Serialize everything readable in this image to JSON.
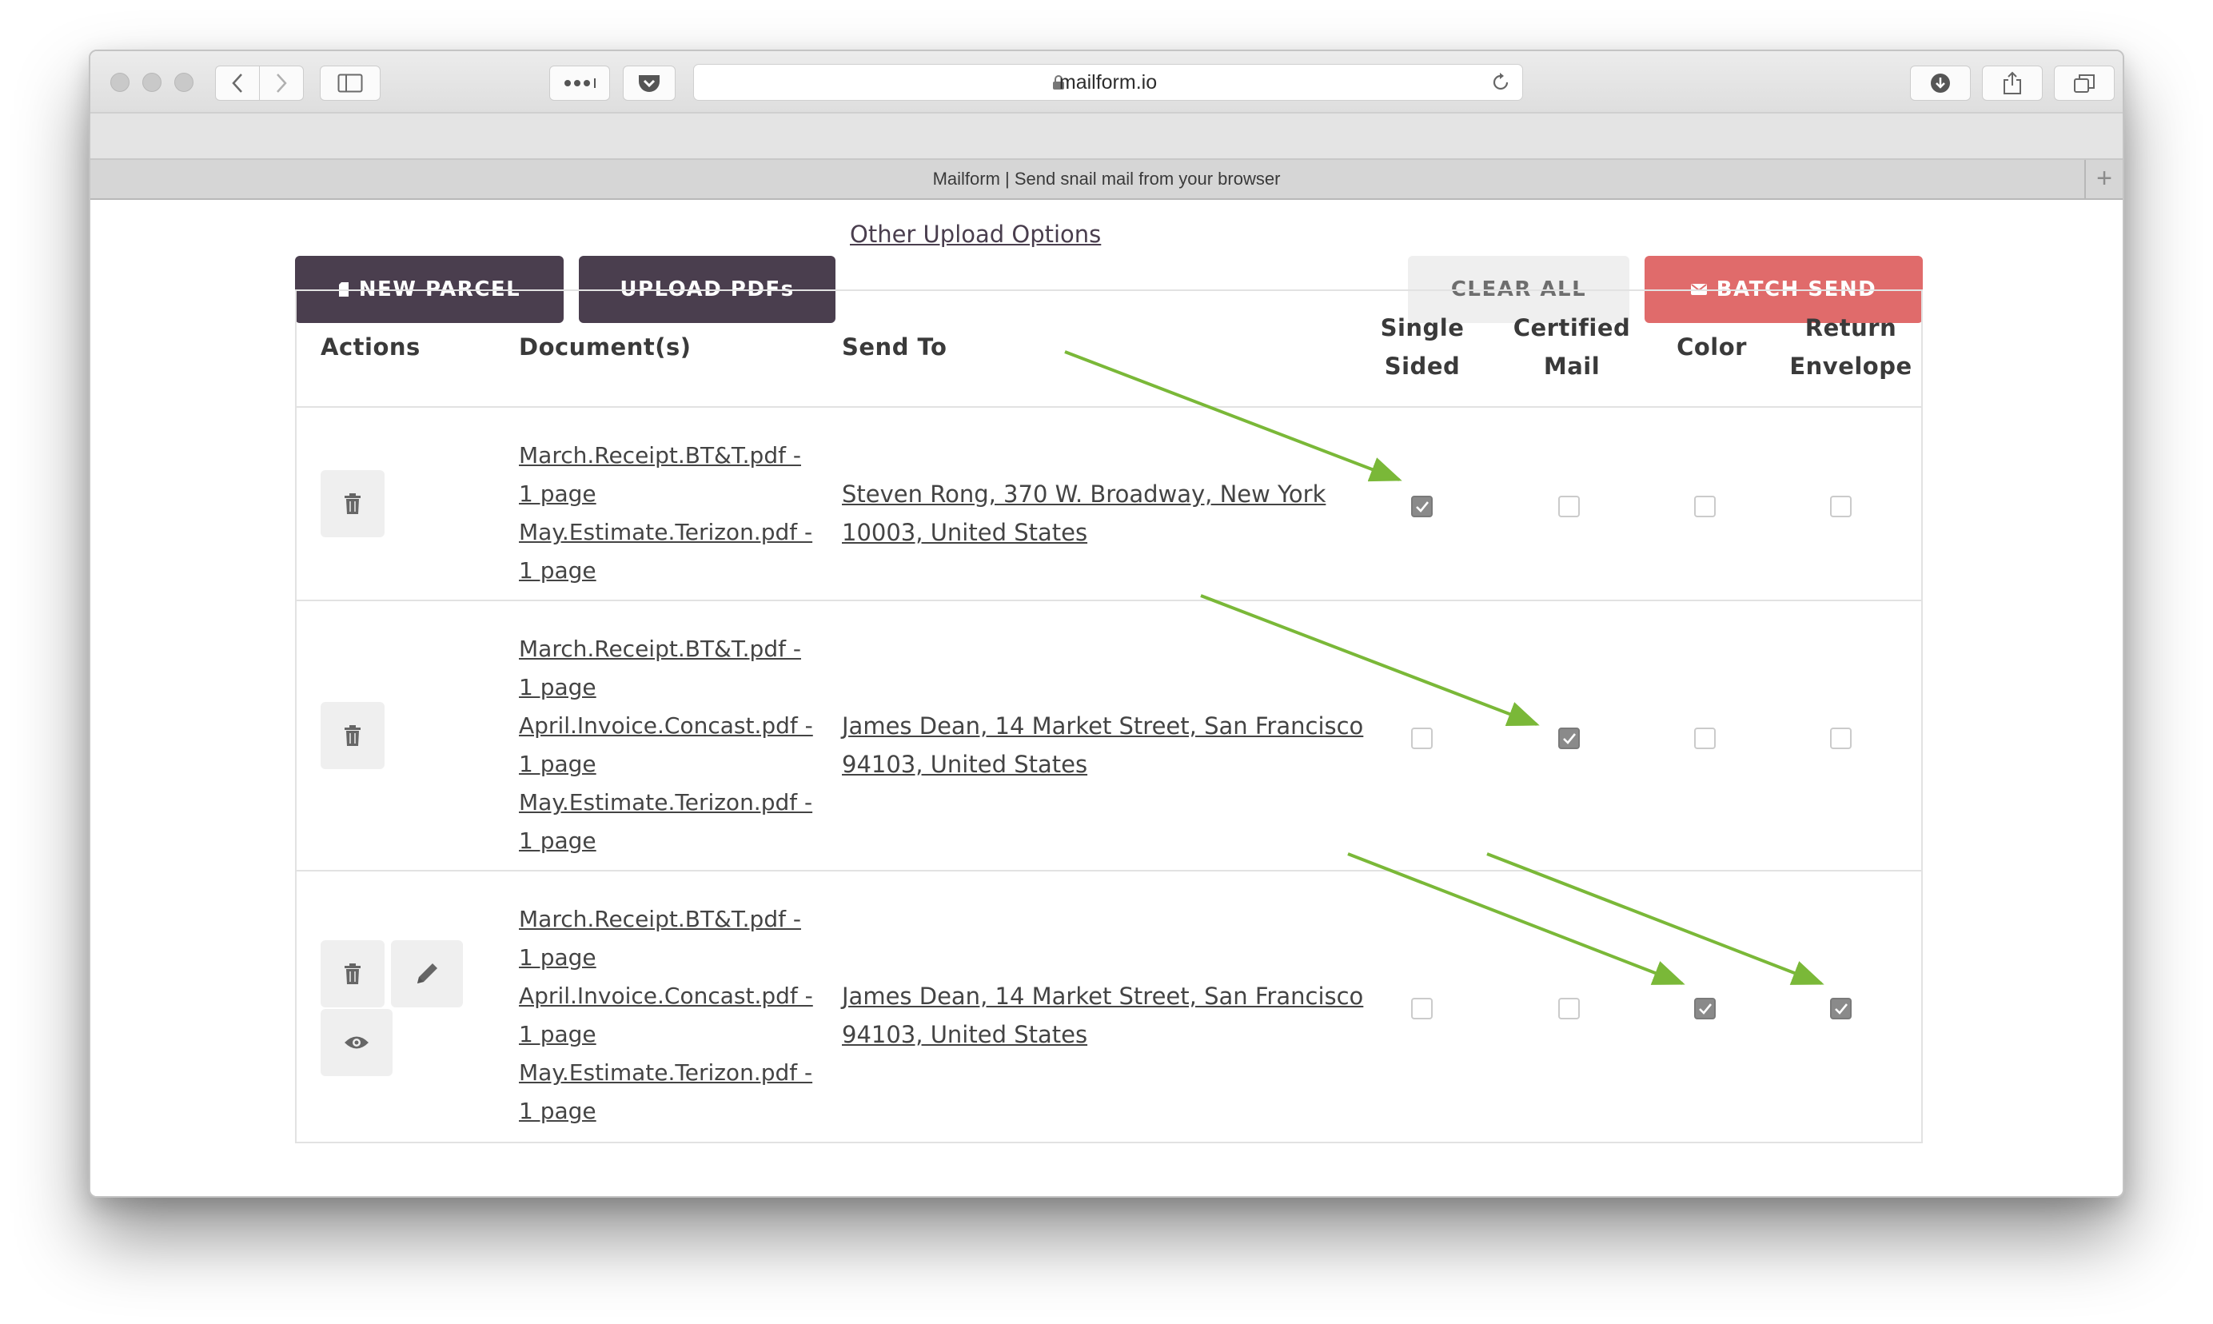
{
  "browser": {
    "url_host": "mailform.io",
    "tab_title": "Mailform | Send snail mail from your browser",
    "new_tab": "+"
  },
  "toolbar": {
    "new_parcel": "NEW PARCEL",
    "upload_pdfs": "UPLOAD PDFs",
    "other_upload": "Other Upload Options",
    "clear_all": "CLEAR ALL",
    "batch_send": "BATCH SEND"
  },
  "table": {
    "headers": {
      "actions": "Actions",
      "documents": "Document(s)",
      "send_to": "Send To",
      "single_1": "Single",
      "single_2": "Sided",
      "certified_1": "Certified",
      "certified_2": "Mail",
      "color": "Color",
      "return_1": "Return",
      "return_2": "Envelope"
    },
    "rows": [
      {
        "docs": [
          "March.Receipt.BT&T.pdf -",
          "1 page",
          "May.Estimate.Terizon.pdf -",
          "1 page"
        ],
        "address_1": "Steven Rong, 370 W. Broadway, New York",
        "address_2": "10003, United States",
        "single_sided": true,
        "certified": false,
        "color": false,
        "return_envelope": false
      },
      {
        "docs": [
          "March.Receipt.BT&T.pdf -",
          "1 page",
          "April.Invoice.Concast.pdf -",
          "1 page",
          "May.Estimate.Terizon.pdf -",
          "1 page"
        ],
        "address_1": "James Dean, 14 Market Street, San Francisco",
        "address_2": "94103, United States",
        "single_sided": false,
        "certified": true,
        "color": false,
        "return_envelope": false
      },
      {
        "docs": [
          "March.Receipt.BT&T.pdf -",
          "1 page",
          "April.Invoice.Concast.pdf -",
          "1 page",
          "May.Estimate.Terizon.pdf -",
          "1 page"
        ],
        "address_1": "James Dean, 14 Market Street, San Francisco",
        "address_2": "94103, United States",
        "single_sided": false,
        "certified": false,
        "color": true,
        "return_envelope": true
      }
    ]
  },
  "colors": {
    "dark_button": "#4a3e4e",
    "batch_send": "#e06b6b",
    "annotation_arrow": "#7ab838"
  }
}
